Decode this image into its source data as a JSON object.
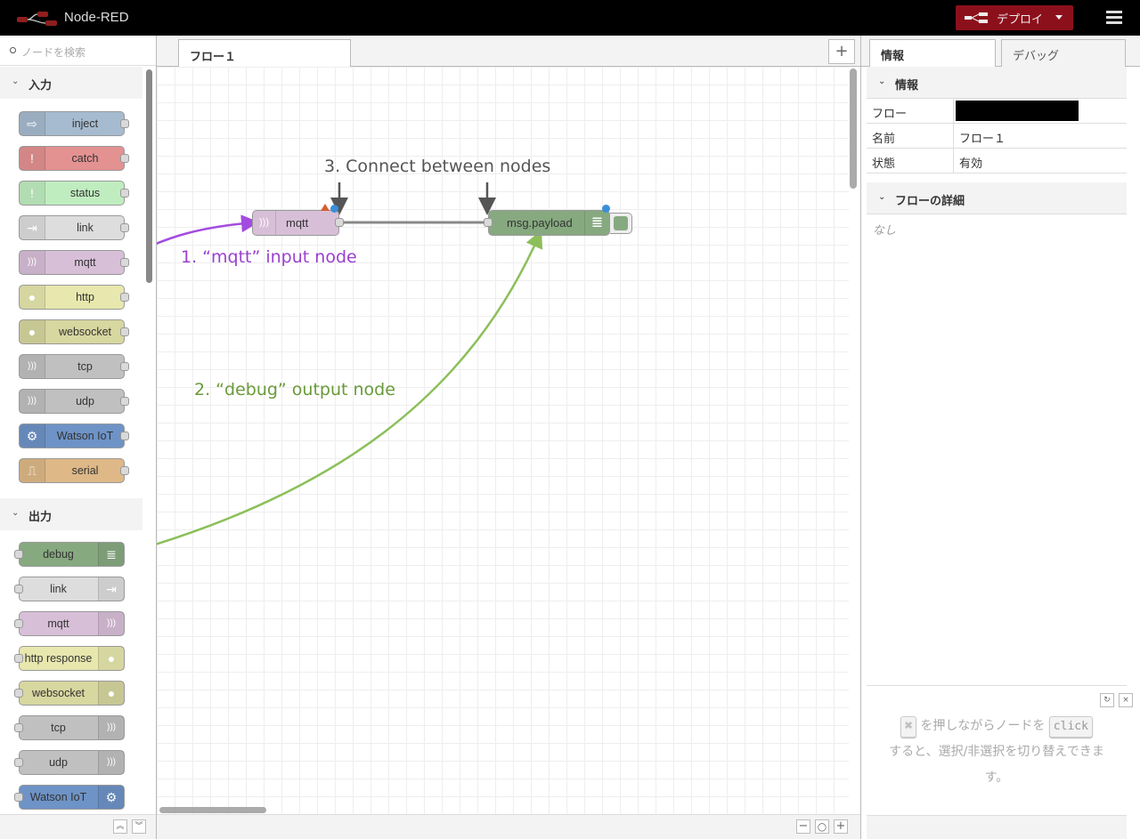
{
  "header": {
    "title": "Node-RED",
    "deploy_label": "デプロイ"
  },
  "palette": {
    "search_placeholder": "ノードを検索",
    "categories": [
      {
        "label": "入力",
        "nodes": [
          {
            "label": "inject",
            "color": "#a6bbcf",
            "icon": "arrow-right-icon",
            "glyph": "⇨"
          },
          {
            "label": "catch",
            "color": "#e49191",
            "icon": "exclamation-icon",
            "glyph": "!"
          },
          {
            "label": "status",
            "color": "#c0edc0",
            "icon": "exclamation-icon",
            "glyph": "!"
          },
          {
            "label": "link",
            "color": "#dddddd",
            "icon": "link-in-icon",
            "glyph": "⇥"
          },
          {
            "label": "mqtt",
            "color": "#d8bfd8",
            "icon": "bridge-icon",
            "glyph": ")))"
          },
          {
            "label": "http",
            "color": "#e7e7ae",
            "icon": "globe-icon",
            "glyph": "●"
          },
          {
            "label": "websocket",
            "color": "#d7d7a0",
            "icon": "globe-icon",
            "glyph": "●"
          },
          {
            "label": "tcp",
            "color": "#c0c0c0",
            "icon": "bridge-icon",
            "glyph": ")))"
          },
          {
            "label": "udp",
            "color": "#c0c0c0",
            "icon": "bridge-icon",
            "glyph": ")))"
          },
          {
            "label": "Watson IoT",
            "color": "#6e93c6",
            "icon": "gear-icon",
            "glyph": "⚙"
          },
          {
            "label": "serial",
            "color": "#deb887",
            "icon": "serial-icon",
            "glyph": "⎍"
          }
        ]
      },
      {
        "label": "出力",
        "nodes": [
          {
            "label": "debug",
            "color": "#87a980",
            "icon": "list-icon",
            "glyph": "≣"
          },
          {
            "label": "link",
            "color": "#dddddd",
            "icon": "link-out-icon",
            "glyph": "⇥"
          },
          {
            "label": "mqtt",
            "color": "#d8bfd8",
            "icon": "bridge-icon",
            "glyph": ")))"
          },
          {
            "label": "http response",
            "color": "#e7e7ae",
            "icon": "globe-icon",
            "glyph": "●"
          },
          {
            "label": "websocket",
            "color": "#d7d7a0",
            "icon": "globe-icon",
            "glyph": "●"
          },
          {
            "label": "tcp",
            "color": "#c0c0c0",
            "icon": "bridge-icon",
            "glyph": ")))"
          },
          {
            "label": "udp",
            "color": "#c0c0c0",
            "icon": "bridge-icon",
            "glyph": ")))"
          },
          {
            "label": "Watson IoT",
            "color": "#6e93c6",
            "icon": "gear-icon",
            "glyph": "⚙"
          }
        ]
      }
    ]
  },
  "workspace": {
    "tab_label": "フロー１",
    "nodes": {
      "mqtt": {
        "label": "mqtt",
        "color": "#d8bfd8"
      },
      "debug": {
        "label": "msg.payload",
        "color": "#87a980"
      }
    },
    "annotations": {
      "a1": {
        "text": "1. “mqtt” input node",
        "color": "#9b3fcf"
      },
      "a2": {
        "text": "2. “debug” output node",
        "color": "#6a9a3a"
      },
      "a3": {
        "text": "3. Connect between nodes",
        "color": "#555555"
      }
    }
  },
  "sidebar": {
    "tabs": [
      "情報",
      "デバッグ"
    ],
    "info_header": "情報",
    "rows": [
      {
        "key": "フロー",
        "value": ""
      },
      {
        "key": "名前",
        "value": "フロー１"
      },
      {
        "key": "状態",
        "value": "有効"
      }
    ],
    "details_header": "フローの詳細",
    "details_value": "なし",
    "help": {
      "key1": "⌘",
      "text1": "を押しながらノードを",
      "key2": "click",
      "text2": "すると、選択/非選択を切り替えできます。"
    }
  }
}
